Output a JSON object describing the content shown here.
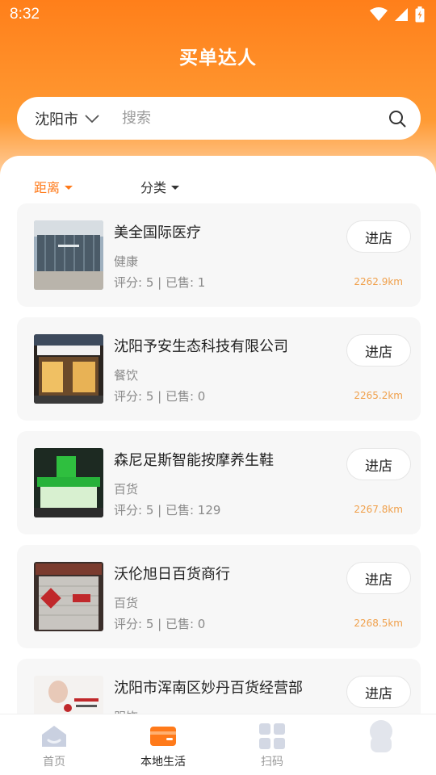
{
  "status_bar": {
    "time": "8:32"
  },
  "header": {
    "title": "买单达人"
  },
  "search": {
    "city": "沈阳市",
    "placeholder": "搜索"
  },
  "filters": [
    {
      "label": "距离",
      "active": true
    },
    {
      "label": "分类",
      "active": false
    }
  ],
  "shops": [
    {
      "name": "美全国际医疗",
      "category": "健康",
      "stats": "评分: 5 | 已售: 1",
      "distance": "2262.9km",
      "button": "进店"
    },
    {
      "name": "沈阳予安生态科技有限公司",
      "category": "餐饮",
      "stats": "评分: 5 | 已售: 0",
      "distance": "2265.2km",
      "button": "进店"
    },
    {
      "name": "森尼足斯智能按摩养生鞋",
      "category": "百货",
      "stats": "评分: 5 | 已售: 129",
      "distance": "2267.8km",
      "button": "进店"
    },
    {
      "name": "沃伦旭日百货商行",
      "category": "百货",
      "stats": "评分: 5 | 已售: 0",
      "distance": "2268.5km",
      "button": "进店"
    },
    {
      "name": "沈阳市浑南区妙丹百货经营部",
      "category": "服饰",
      "stats": "",
      "distance": "",
      "button": "进店"
    }
  ],
  "tabbar": [
    {
      "label": "首页",
      "icon": "home-icon",
      "active": false
    },
    {
      "label": "本地生活",
      "icon": "wallet-icon",
      "active": true
    },
    {
      "label": "扫码",
      "icon": "grid-icon",
      "active": false
    },
    {
      "label": "",
      "icon": "profile-icon",
      "active": false
    }
  ],
  "colors": {
    "accent": "#ff7a1a",
    "distance": "#f0a04b",
    "card_bg": "#f7f7f7"
  }
}
